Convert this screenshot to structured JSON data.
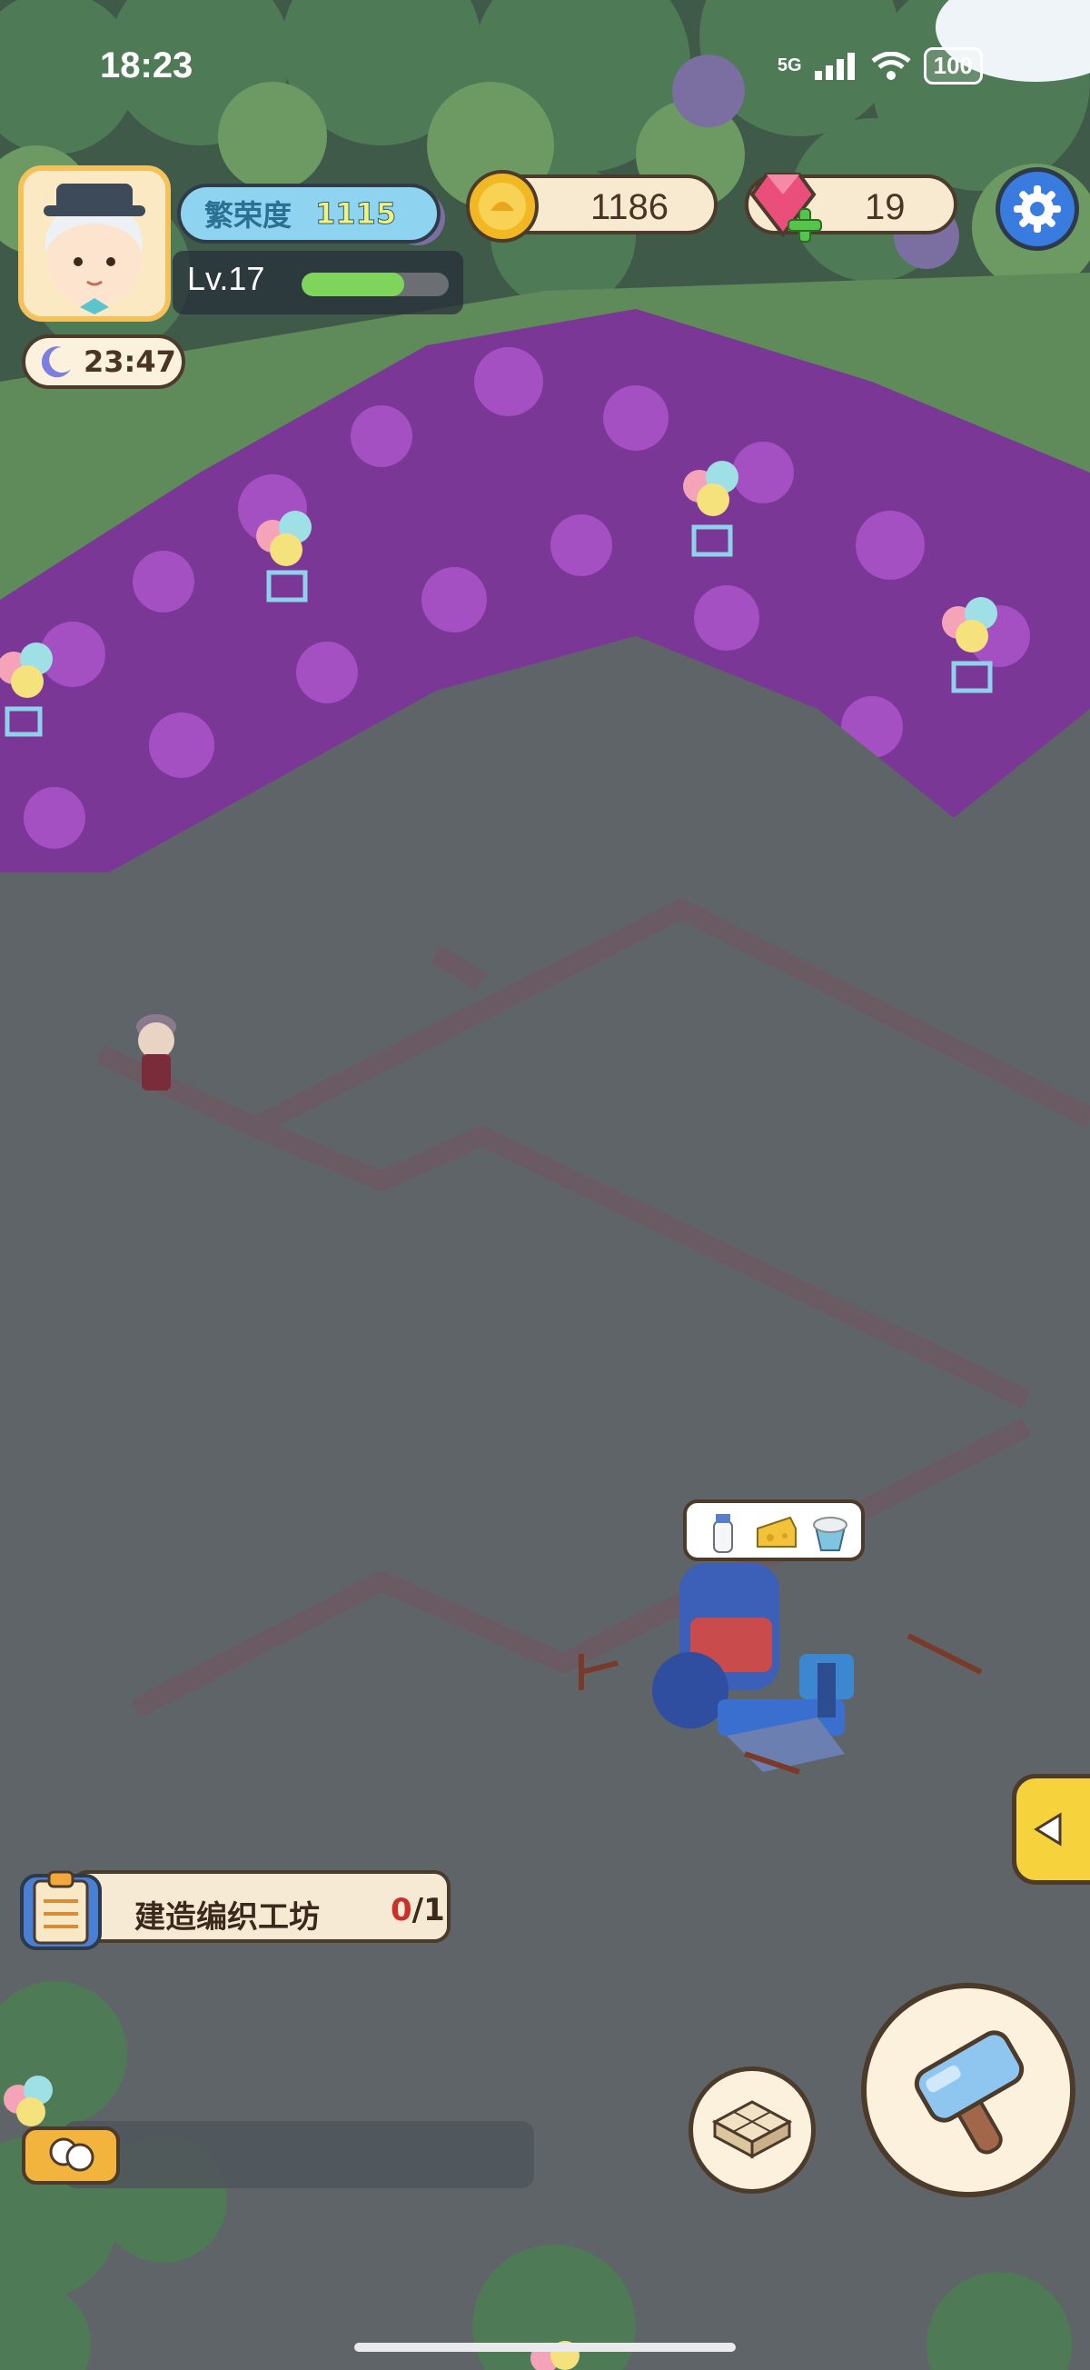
{
  "status_bar": {
    "time": "18:23",
    "network": "5G",
    "battery": "100",
    "icons": [
      "cellular-signal-icon",
      "wifi-icon",
      "battery-icon"
    ]
  },
  "player": {
    "prosperity_label": "繁荣度",
    "prosperity_value": "1115",
    "level": "Lv.17",
    "xp_progress": 0.7,
    "night_timer": "23:47"
  },
  "currency": {
    "coins": "1186",
    "gems": "19"
  },
  "quest": {
    "title": "建造编织工坊",
    "progress_current": "0",
    "progress_total": "/1"
  },
  "production_bubble": {
    "items": [
      "milk-bottle-icon",
      "cheese-icon",
      "yogurt-icon"
    ]
  },
  "buttons": {
    "settings": "gear-icon",
    "side_tab": "triangle-left-icon",
    "chat": "chat-bubbles-icon",
    "floor_tile": "floor-tile-icon",
    "build": "hammer-icon"
  },
  "colors": {
    "ground": "#5f6469",
    "flowers": "#8b3aa8",
    "grass": "#5f8a5a",
    "accent_blue": "#3a7be0",
    "panel_cream": "#f8ead0",
    "xp_green": "#7fd55b",
    "quest_red": "#c9322a"
  }
}
